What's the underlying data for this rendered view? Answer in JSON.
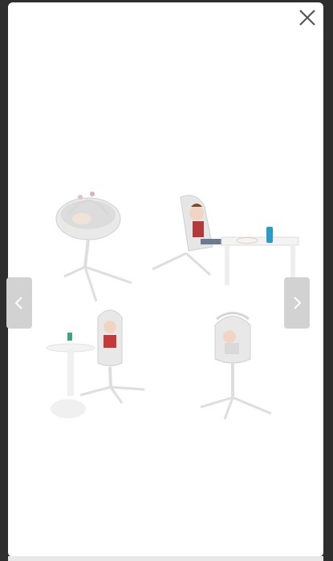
{
  "gallery": {
    "close_icon": "close-icon",
    "prev_icon": "chevron-left-icon",
    "next_icon": "chevron-right-icon",
    "colors": {
      "modal_bg": "#ffffff",
      "backdrop": "#2e2e2e",
      "nav_button_bg": "#d2d2d2",
      "icon_color": "#555555"
    },
    "image": {
      "configurations": [
        "bassinet",
        "recliner",
        "highchair",
        "chair"
      ]
    }
  }
}
